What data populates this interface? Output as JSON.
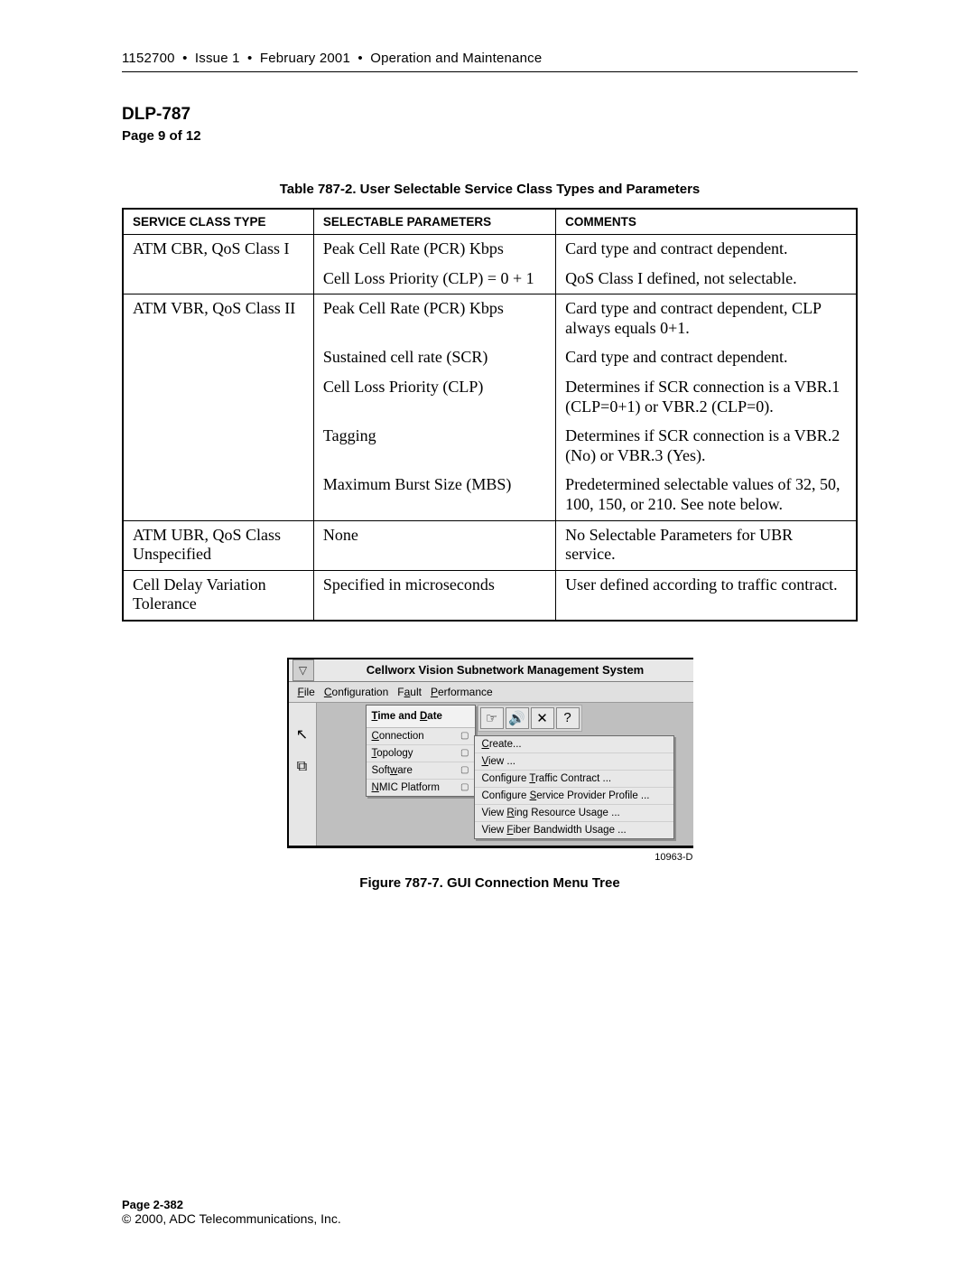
{
  "header": {
    "doc_id": "1152700",
    "issue": "Issue 1",
    "date": "February 2001",
    "section": "Operation and Maintenance"
  },
  "title_block": {
    "dlp": "DLP-787",
    "page_n": "Page 9 of 12"
  },
  "table_caption": "Table 787-2. User Selectable Service Class Types and Parameters",
  "table": {
    "headers": [
      "SERVICE CLASS TYPE",
      "SELECTABLE PARAMETERS",
      "COMMENTS"
    ],
    "rows": [
      {
        "c0": "ATM CBR, QoS Class I",
        "c1": "Peak Cell Rate (PCR) Kbps",
        "c2": "Card type and contract dependent."
      },
      {
        "c0": "",
        "c1": "Cell Loss Priority (CLP) = 0 + 1",
        "c2": "QoS Class I defined, not selectable."
      },
      {
        "c0": "ATM VBR, QoS Class II",
        "c1": "Peak Cell Rate (PCR) Kbps",
        "c2": "Card type and contract dependent, CLP always equals 0+1."
      },
      {
        "c0": "",
        "c1": "Sustained cell rate (SCR)",
        "c2": "Card type and contract dependent."
      },
      {
        "c0": "",
        "c1": "Cell Loss Priority (CLP)",
        "c2": "Determines if SCR connection is a VBR.1 (CLP=0+1) or VBR.2 (CLP=0)."
      },
      {
        "c0": "",
        "c1": "Tagging",
        "c2": "Determines if SCR connection is a VBR.2 (No) or VBR.3 (Yes)."
      },
      {
        "c0": "",
        "c1": "Maximum Burst Size (MBS)",
        "c2": "Predetermined selectable values of 32, 50, 100, 150, or 210. See note below."
      },
      {
        "c0": "ATM UBR, QoS Class Unspecified",
        "c1": "None",
        "c2": "No Selectable Parameters for UBR service."
      },
      {
        "c0": "Cell Delay Variation Tolerance",
        "c1": "Specified in microseconds",
        "c2": "User defined according to traffic contract."
      }
    ]
  },
  "gui": {
    "title": "Cellworx Vision Subnetwork Management System",
    "menubar": [
      "File",
      "Configuration",
      "Fault",
      "Performance"
    ],
    "toolbar_icons": [
      "hand-icon",
      "speaker-icon",
      "chart-icon",
      "help-icon"
    ],
    "drop1_header": "Time and Date",
    "drop1_items": [
      "Connection",
      "Topology",
      "Software",
      "NMIC Platform"
    ],
    "drop2_items": [
      "Create...",
      "View ...",
      "Configure Traffic Contract ...",
      "Configure Service Provider Profile ...",
      "View Ring Resource Usage ...",
      "View Fiber Bandwidth Usage ..."
    ]
  },
  "figure_id": "10963-D",
  "figure_caption": "Figure 787-7. GUI Connection Menu Tree",
  "footer": {
    "page": "Page 2-382",
    "copyright": "© 2000, ADC Telecommunications, Inc."
  }
}
